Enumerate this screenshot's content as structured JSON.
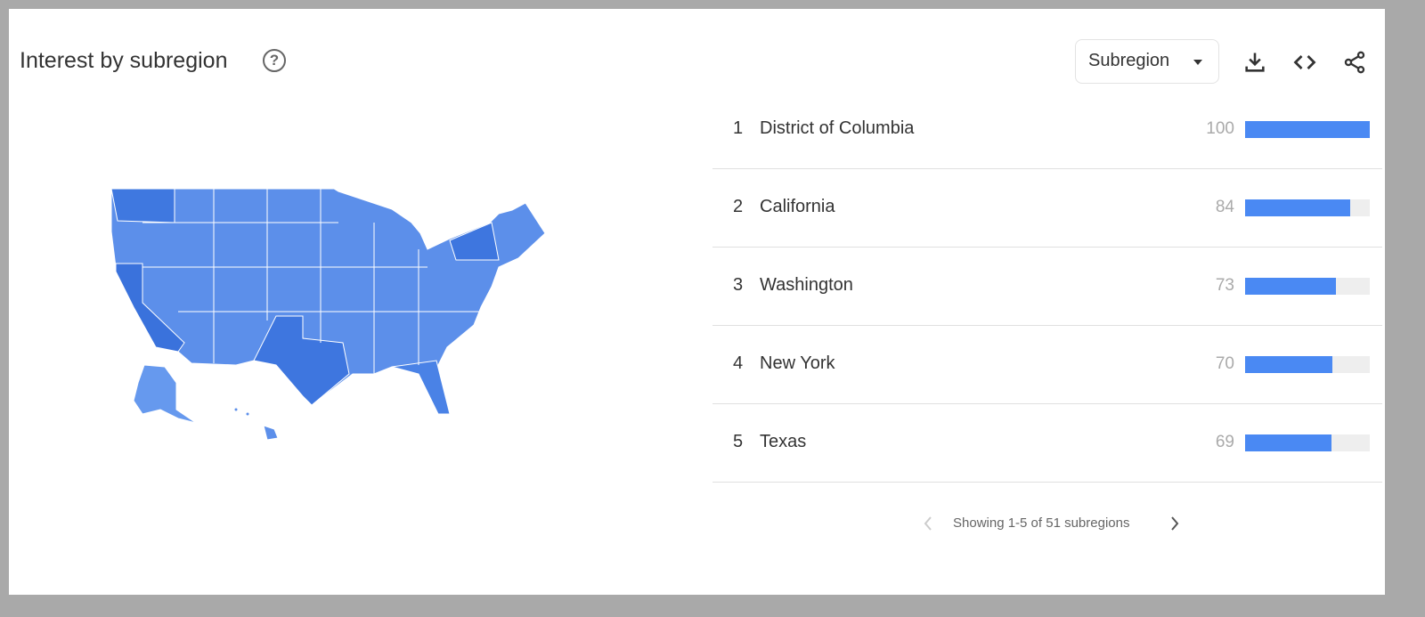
{
  "header": {
    "title": "Interest by subregion",
    "help_icon": "help-circle-icon",
    "select_value": "Subregion"
  },
  "toolbar": {
    "icons": [
      "download-icon",
      "embed-code-icon",
      "share-icon"
    ]
  },
  "colors": {
    "bar": "#4a89f3",
    "track": "#eeeeee",
    "map_base": "#5c8fea",
    "map_dark": "#3a72dc"
  },
  "rows": [
    {
      "rank": "1",
      "name": "District of Columbia",
      "value": "100",
      "pct": 100
    },
    {
      "rank": "2",
      "name": "California",
      "value": "84",
      "pct": 84
    },
    {
      "rank": "3",
      "name": "Washington",
      "value": "73",
      "pct": 73
    },
    {
      "rank": "4",
      "name": "New York",
      "value": "70",
      "pct": 70
    },
    {
      "rank": "5",
      "name": "Texas",
      "value": "69",
      "pct": 69
    }
  ],
  "pager": {
    "text": "Showing 1-5 of 51 subregions"
  }
}
